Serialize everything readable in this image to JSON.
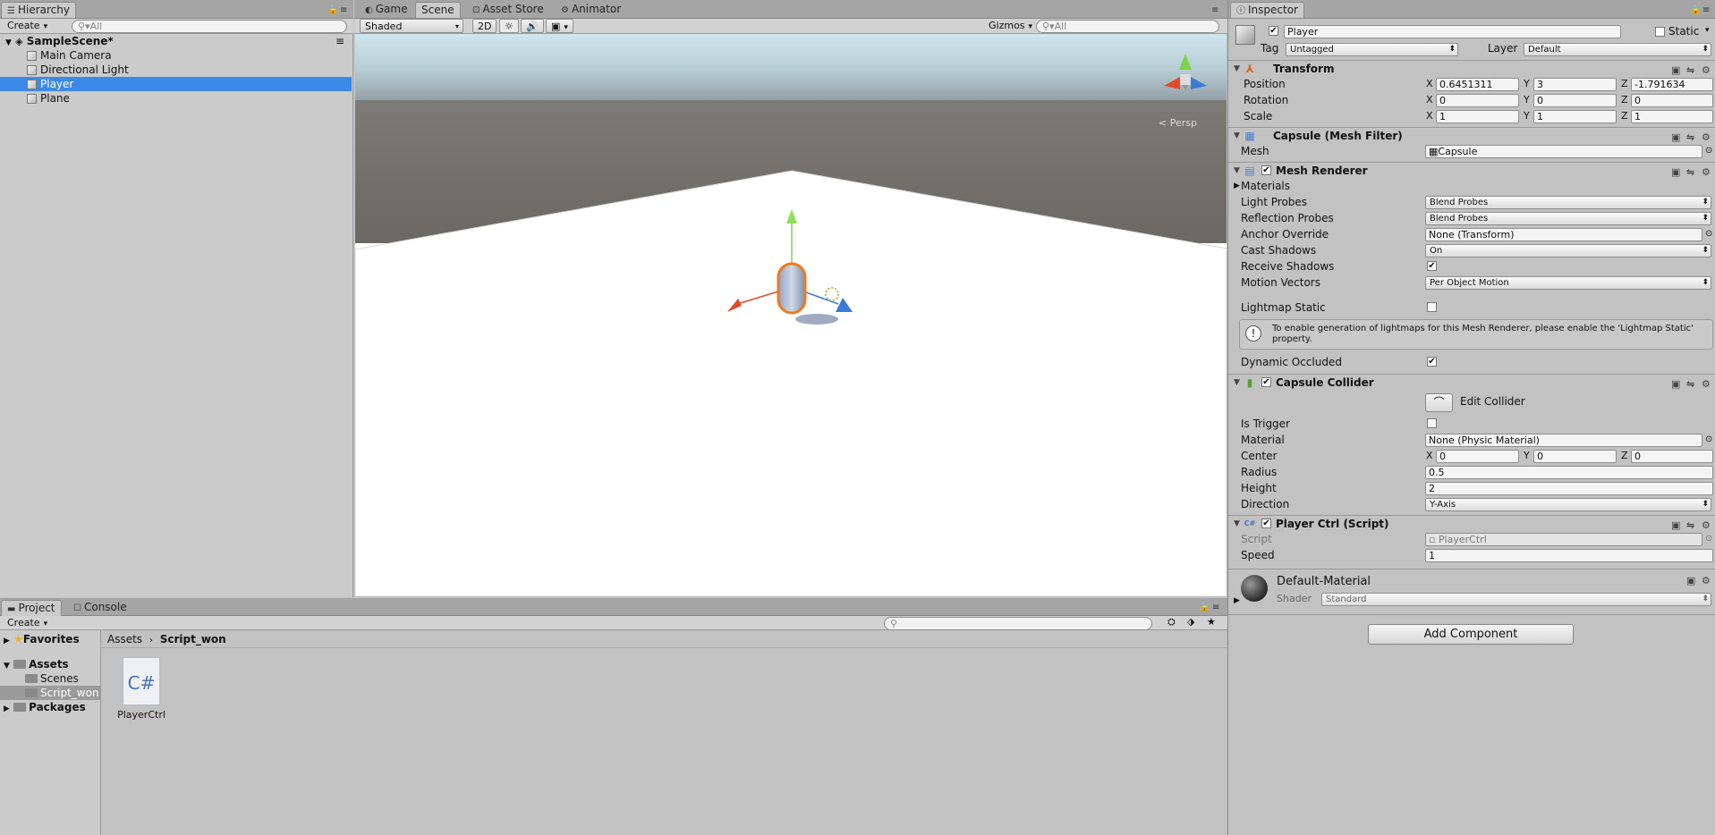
{
  "hierarchy": {
    "tab": "Hierarchy",
    "create": "Create",
    "search": "All",
    "scene": "SampleScene*",
    "items": [
      "Main Camera",
      "Directional Light",
      "Player",
      "Plane"
    ]
  },
  "scene_tabs": [
    "Game",
    "Scene",
    "Asset Store",
    "Animator"
  ],
  "scene_toolbar": {
    "shading": "Shaded",
    "mode_2d": "2D",
    "gizmos": "Gizmos",
    "search": "All",
    "persp": "Persp"
  },
  "inspector": {
    "tab": "Inspector",
    "name": "Player",
    "static_label": "Static",
    "tag_label": "Tag",
    "tag": "Untagged",
    "layer_label": "Layer",
    "layer": "Default",
    "transform": {
      "title": "Transform",
      "position_label": "Position",
      "rotation_label": "Rotation",
      "scale_label": "Scale",
      "position": [
        "0.6451311",
        "3",
        "-1.791634"
      ],
      "rotation": [
        "0",
        "0",
        "0"
      ],
      "scale": [
        "1",
        "1",
        "1"
      ],
      "axes": [
        "X",
        "Y",
        "Z"
      ]
    },
    "mesh_filter": {
      "title": "Capsule (Mesh Filter)",
      "mesh_label": "Mesh",
      "mesh": "Capsule"
    },
    "mesh_renderer": {
      "title": "Mesh Renderer",
      "materials": "Materials",
      "light_probes_label": "Light Probes",
      "light_probes": "Blend Probes",
      "reflection_label": "Reflection Probes",
      "reflection": "Blend Probes",
      "anchor_label": "Anchor Override",
      "anchor": "None (Transform)",
      "cast_label": "Cast Shadows",
      "cast": "On",
      "receive_label": "Receive Shadows",
      "motion_label": "Motion Vectors",
      "motion": "Per Object Motion",
      "lightmap_label": "Lightmap Static",
      "help": "To enable generation of lightmaps for this Mesh Renderer, please enable the 'Lightmap Static' property.",
      "dynamic_label": "Dynamic Occluded"
    },
    "capsule_collider": {
      "title": "Capsule Collider",
      "edit": "Edit Collider",
      "trigger_label": "Is Trigger",
      "material_label": "Material",
      "material": "None (Physic Material)",
      "center_label": "Center",
      "center": [
        "0",
        "0",
        "0"
      ],
      "radius_label": "Radius",
      "radius": "0.5",
      "height_label": "Height",
      "height": "2",
      "direction_label": "Direction",
      "direction": "Y-Axis"
    },
    "script": {
      "title": "Player Ctrl (Script)",
      "script_label": "Script",
      "script": "PlayerCtrl",
      "speed_label": "Speed",
      "speed": "1"
    },
    "material": {
      "name": "Default-Material",
      "shader_label": "Shader",
      "shader": "Standard"
    },
    "add_component": "Add Component"
  },
  "project": {
    "tabs": [
      "Project",
      "Console"
    ],
    "create": "Create",
    "breadcrumb": [
      "Assets",
      "Script_won"
    ],
    "favorites": "Favorites",
    "assets": "Assets",
    "folders": [
      "Scenes",
      "Script_won"
    ],
    "packages": "Packages",
    "file_icon": "C#",
    "file": "PlayerCtrl"
  }
}
